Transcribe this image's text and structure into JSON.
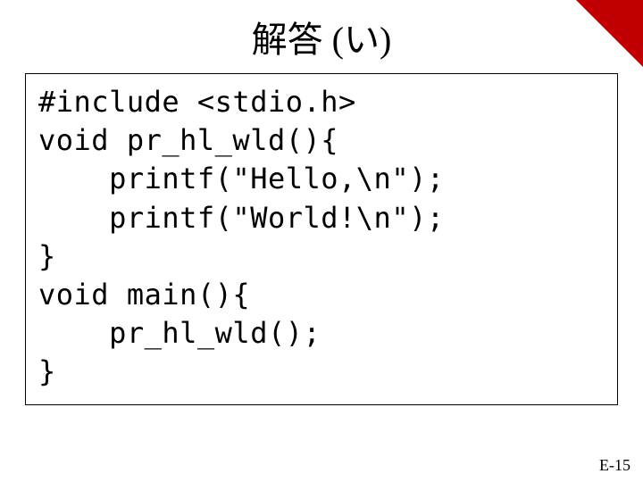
{
  "title": "解答 (い)",
  "code": {
    "l1": "#include <stdio.h>",
    "l2": "void pr_hl_wld(){",
    "l3": "    printf(\"Hello,\\n\");",
    "l4": "    printf(\"World!\\n\");",
    "l5": "}",
    "l6": "void main(){",
    "l7": "    pr_hl_wld();",
    "l8": "}"
  },
  "page_number": "E-15"
}
